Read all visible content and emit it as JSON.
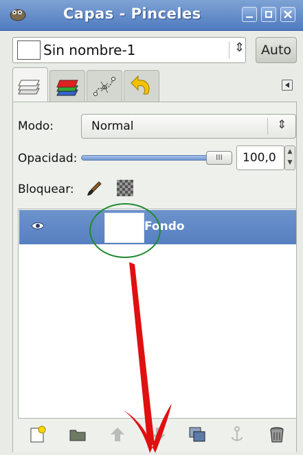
{
  "window": {
    "title": "Capas - Pinceles"
  },
  "image_selector": {
    "name": "Sin nombre-1",
    "auto_label": "Auto"
  },
  "tabs": [
    {
      "icon": "layers-icon",
      "active": true
    },
    {
      "icon": "channels-icon",
      "active": false
    },
    {
      "icon": "paths-icon",
      "active": false
    },
    {
      "icon": "undo-history-icon",
      "active": false
    }
  ],
  "mode": {
    "label": "Modo:",
    "value": "Normal"
  },
  "opacity": {
    "label": "Opacidad:",
    "value": "100,0",
    "level": 1.0,
    "handle_text": "III"
  },
  "lock": {
    "label": "Bloquear:"
  },
  "layers": [
    {
      "name": "Fondo",
      "visible": true,
      "selected": true
    }
  ],
  "bottom_toolbar": [
    "new-layer-icon",
    "new-layer-group-icon",
    "raise-layer-icon",
    "lower-layer-icon",
    "duplicate-layer-icon",
    "anchor-layer-icon",
    "delete-layer-icon"
  ],
  "colors": {
    "titlebar": "#5f88c6",
    "selection": "#6189c7",
    "annotation_circle": "#1f8a2e",
    "annotation_arrow": "#e01010"
  }
}
